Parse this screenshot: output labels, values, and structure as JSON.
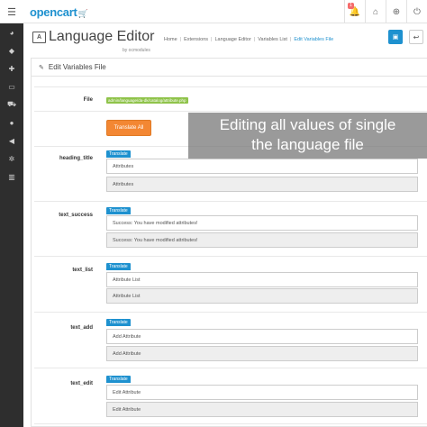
{
  "header": {
    "logo": "opencart",
    "notification_count": "1"
  },
  "page": {
    "title": "Language Editor",
    "subtitle": "by ocmodules",
    "breadcrumb": [
      "Home",
      "Extensions",
      "Language Editor",
      "Variables List",
      "Edit Variables File"
    ]
  },
  "panel": {
    "heading": "Edit Variables File",
    "file_label": "File",
    "file_path": "admin/language/da-dk/catalog/attribute.php",
    "translate_all": "Translate All",
    "translate": "Translate"
  },
  "overlay": {
    "line1": "Editing all values of single",
    "line2": "the language file"
  },
  "fields": [
    {
      "key": "heading_title",
      "value": "Attributes",
      "original": "Attributes"
    },
    {
      "key": "text_success",
      "value": "Success: You have modified attributes!",
      "original": "Success: You have modified attributes!"
    },
    {
      "key": "text_list",
      "value": "Attribute List",
      "original": "Attribute List"
    },
    {
      "key": "text_add",
      "value": "Add Attribute",
      "original": "Add Attribute"
    },
    {
      "key": "text_edit",
      "value": "Edit Attribute",
      "original": "Edit Attribute"
    }
  ],
  "icons": {
    "menu": "menu-icon",
    "bell": "bell-icon",
    "home": "home-icon",
    "help": "lifebuoy-icon",
    "logout": "logout-icon",
    "save": "save-icon",
    "back": "reply-icon",
    "edit": "pencil-icon"
  },
  "colors": {
    "brand": "#1e91cf",
    "sidebar": "#2e2e2e",
    "translate_all": "#f38733",
    "file_badge": "#8fc34a"
  }
}
